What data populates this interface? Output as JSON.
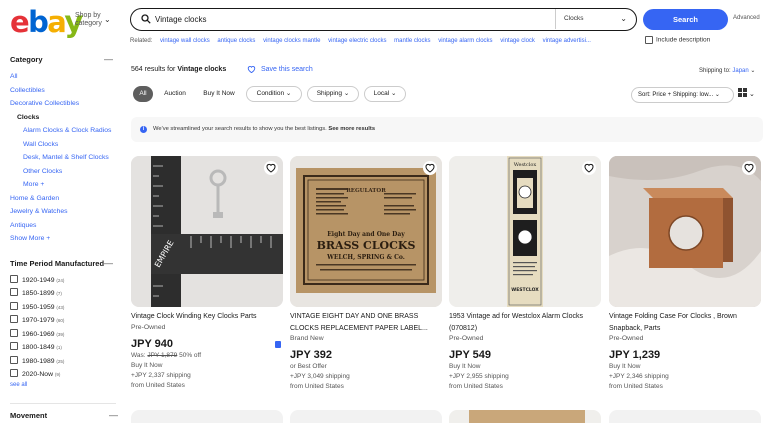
{
  "header": {
    "logo": "ebay",
    "shop_by": "Shop by category",
    "search_value": "Vintage clocks",
    "search_category": "Clocks",
    "search_button": "Search",
    "advanced": "Advanced",
    "related_label": "Related:",
    "related": [
      "vintage wall clocks",
      "antique clocks",
      "vintage clocks mantle",
      "vintage electric clocks",
      "mantle clocks",
      "vintage alarm clocks",
      "vintage clock",
      "vintage advertisi..."
    ],
    "include_description": "Include description"
  },
  "sidebar": {
    "category_heading": "Category",
    "categories": [
      {
        "label": "All",
        "style": "link"
      },
      {
        "label": "Collectibles",
        "style": "link"
      },
      {
        "label": "Decorative Collectibles",
        "style": "link"
      },
      {
        "label": "Clocks",
        "style": "bold"
      },
      {
        "label": "Alarm Clocks & Clock Radios",
        "style": "indent"
      },
      {
        "label": "Wall Clocks",
        "style": "indent"
      },
      {
        "label": "Desk, Mantel & Shelf Clocks",
        "style": "indent"
      },
      {
        "label": "Other Clocks",
        "style": "indent"
      },
      {
        "label": "More +",
        "style": "indent"
      },
      {
        "label": "Home & Garden",
        "style": "link"
      },
      {
        "label": "Jewelry & Watches",
        "style": "link"
      },
      {
        "label": "Antiques",
        "style": "link"
      },
      {
        "label": "Show More +",
        "style": "link"
      }
    ],
    "period_heading": "Time Period Manufactured",
    "periods": [
      {
        "label": "1920-1949",
        "count": "(24)"
      },
      {
        "label": "1850-1899",
        "count": "(7)"
      },
      {
        "label": "1950-1959",
        "count": "(43)"
      },
      {
        "label": "1970-1979",
        "count": "(60)"
      },
      {
        "label": "1960-1969",
        "count": "(39)"
      },
      {
        "label": "1800-1849",
        "count": "(1)"
      },
      {
        "label": "1980-1989",
        "count": "(25)"
      },
      {
        "label": "2020-Now",
        "count": "(9)"
      }
    ],
    "see_all": "see all",
    "movement_heading": "Movement"
  },
  "results": {
    "count": "564 results for",
    "query": "Vintage clocks",
    "save_search": "Save this search",
    "shipping_to_label": "Shipping to:",
    "shipping_to_value": "Japan"
  },
  "filters": {
    "chips": [
      "All",
      "Auction",
      "Buy It Now",
      "Condition",
      "Shipping",
      "Local"
    ],
    "sort": "Sort: Price + Shipping: low...",
    "view_icon": "grid-view-icon"
  },
  "banner": {
    "text": "We've streamlined your search results to show you the best listings.",
    "link": "See more results"
  },
  "listings": [
    {
      "title": "Vintage Clock Winding Key Clocks Parts",
      "condition": "Pre-Owned",
      "price": "JPY 940",
      "was": "Was:",
      "was_price": "JPY 1,879",
      "discount": "50% off",
      "lines": [
        "Buy It Now",
        "+JPY 2,337 shipping",
        "from United States"
      ]
    },
    {
      "title": "VINTAGE EIGHT DAY AND ONE BRASS CLOCKS REPLACEMENT PAPER LABEL...",
      "condition": "Brand New",
      "price": "JPY 392",
      "lines": [
        "or Best Offer",
        "+JPY 3,049 shipping",
        "from United States"
      ]
    },
    {
      "title": "1953 Vintage ad for Westclox Alarm Clocks (070812)",
      "condition": "Pre-Owned",
      "price": "JPY 549",
      "lines": [
        "Buy It Now",
        "+JPY 2,955 shipping",
        "from United States"
      ]
    },
    {
      "title": "Vintage Folding Case For Clocks , Brown Snapback, Parts",
      "condition": "Pre-Owned",
      "price": "JPY 1,239",
      "lines": [
        "Buy It Now",
        "+JPY 2,346 shipping",
        "from United States"
      ]
    }
  ],
  "label_art": {
    "line1": "BRASS CLOCKS",
    "line2": "Eight Day and One Day",
    "line3": "WELCH, SPRING & Co.",
    "line4": "REGULATOR",
    "ruler_brand": "EMPIRE",
    "ad_brand": "Westclox",
    "ad_footer": "WESTCLOX"
  },
  "colors": {
    "accent": "#3665f3",
    "chip_active": "#5e5e5e",
    "logo_e": "#e53238",
    "logo_b": "#0064d2",
    "logo_a": "#f5af02",
    "logo_y": "#86b817"
  }
}
